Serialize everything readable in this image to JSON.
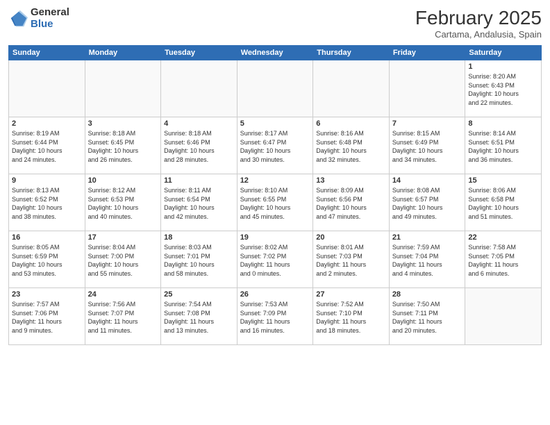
{
  "logo": {
    "general": "General",
    "blue": "Blue"
  },
  "header": {
    "month": "February 2025",
    "location": "Cartama, Andalusia, Spain"
  },
  "weekdays": [
    "Sunday",
    "Monday",
    "Tuesday",
    "Wednesday",
    "Thursday",
    "Friday",
    "Saturday"
  ],
  "weeks": [
    [
      {
        "day": "",
        "info": ""
      },
      {
        "day": "",
        "info": ""
      },
      {
        "day": "",
        "info": ""
      },
      {
        "day": "",
        "info": ""
      },
      {
        "day": "",
        "info": ""
      },
      {
        "day": "",
        "info": ""
      },
      {
        "day": "1",
        "info": "Sunrise: 8:20 AM\nSunset: 6:43 PM\nDaylight: 10 hours\nand 22 minutes."
      }
    ],
    [
      {
        "day": "2",
        "info": "Sunrise: 8:19 AM\nSunset: 6:44 PM\nDaylight: 10 hours\nand 24 minutes."
      },
      {
        "day": "3",
        "info": "Sunrise: 8:18 AM\nSunset: 6:45 PM\nDaylight: 10 hours\nand 26 minutes."
      },
      {
        "day": "4",
        "info": "Sunrise: 8:18 AM\nSunset: 6:46 PM\nDaylight: 10 hours\nand 28 minutes."
      },
      {
        "day": "5",
        "info": "Sunrise: 8:17 AM\nSunset: 6:47 PM\nDaylight: 10 hours\nand 30 minutes."
      },
      {
        "day": "6",
        "info": "Sunrise: 8:16 AM\nSunset: 6:48 PM\nDaylight: 10 hours\nand 32 minutes."
      },
      {
        "day": "7",
        "info": "Sunrise: 8:15 AM\nSunset: 6:49 PM\nDaylight: 10 hours\nand 34 minutes."
      },
      {
        "day": "8",
        "info": "Sunrise: 8:14 AM\nSunset: 6:51 PM\nDaylight: 10 hours\nand 36 minutes."
      }
    ],
    [
      {
        "day": "9",
        "info": "Sunrise: 8:13 AM\nSunset: 6:52 PM\nDaylight: 10 hours\nand 38 minutes."
      },
      {
        "day": "10",
        "info": "Sunrise: 8:12 AM\nSunset: 6:53 PM\nDaylight: 10 hours\nand 40 minutes."
      },
      {
        "day": "11",
        "info": "Sunrise: 8:11 AM\nSunset: 6:54 PM\nDaylight: 10 hours\nand 42 minutes."
      },
      {
        "day": "12",
        "info": "Sunrise: 8:10 AM\nSunset: 6:55 PM\nDaylight: 10 hours\nand 45 minutes."
      },
      {
        "day": "13",
        "info": "Sunrise: 8:09 AM\nSunset: 6:56 PM\nDaylight: 10 hours\nand 47 minutes."
      },
      {
        "day": "14",
        "info": "Sunrise: 8:08 AM\nSunset: 6:57 PM\nDaylight: 10 hours\nand 49 minutes."
      },
      {
        "day": "15",
        "info": "Sunrise: 8:06 AM\nSunset: 6:58 PM\nDaylight: 10 hours\nand 51 minutes."
      }
    ],
    [
      {
        "day": "16",
        "info": "Sunrise: 8:05 AM\nSunset: 6:59 PM\nDaylight: 10 hours\nand 53 minutes."
      },
      {
        "day": "17",
        "info": "Sunrise: 8:04 AM\nSunset: 7:00 PM\nDaylight: 10 hours\nand 55 minutes."
      },
      {
        "day": "18",
        "info": "Sunrise: 8:03 AM\nSunset: 7:01 PM\nDaylight: 10 hours\nand 58 minutes."
      },
      {
        "day": "19",
        "info": "Sunrise: 8:02 AM\nSunset: 7:02 PM\nDaylight: 11 hours\nand 0 minutes."
      },
      {
        "day": "20",
        "info": "Sunrise: 8:01 AM\nSunset: 7:03 PM\nDaylight: 11 hours\nand 2 minutes."
      },
      {
        "day": "21",
        "info": "Sunrise: 7:59 AM\nSunset: 7:04 PM\nDaylight: 11 hours\nand 4 minutes."
      },
      {
        "day": "22",
        "info": "Sunrise: 7:58 AM\nSunset: 7:05 PM\nDaylight: 11 hours\nand 6 minutes."
      }
    ],
    [
      {
        "day": "23",
        "info": "Sunrise: 7:57 AM\nSunset: 7:06 PM\nDaylight: 11 hours\nand 9 minutes."
      },
      {
        "day": "24",
        "info": "Sunrise: 7:56 AM\nSunset: 7:07 PM\nDaylight: 11 hours\nand 11 minutes."
      },
      {
        "day": "25",
        "info": "Sunrise: 7:54 AM\nSunset: 7:08 PM\nDaylight: 11 hours\nand 13 minutes."
      },
      {
        "day": "26",
        "info": "Sunrise: 7:53 AM\nSunset: 7:09 PM\nDaylight: 11 hours\nand 16 minutes."
      },
      {
        "day": "27",
        "info": "Sunrise: 7:52 AM\nSunset: 7:10 PM\nDaylight: 11 hours\nand 18 minutes."
      },
      {
        "day": "28",
        "info": "Sunrise: 7:50 AM\nSunset: 7:11 PM\nDaylight: 11 hours\nand 20 minutes."
      },
      {
        "day": "",
        "info": ""
      }
    ]
  ]
}
